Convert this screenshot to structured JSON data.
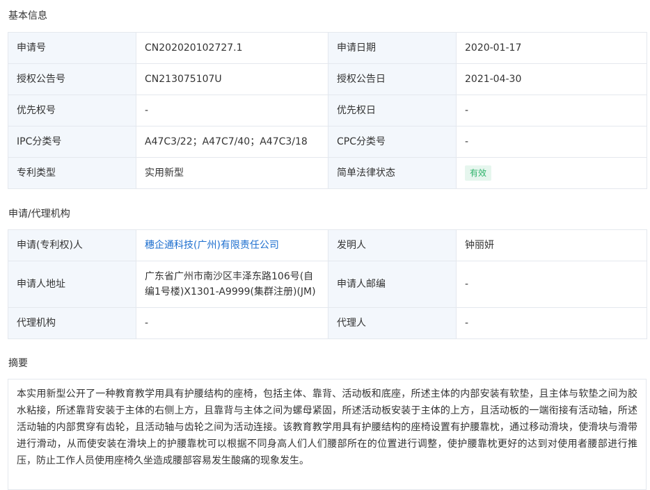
{
  "basic": {
    "title": "基本信息",
    "rows": [
      {
        "k1": "申请号",
        "v1": "CN202020102727.1",
        "k2": "申请日期",
        "v2": "2020-01-17"
      },
      {
        "k1": "授权公告号",
        "v1": "CN213075107U",
        "k2": "授权公告日",
        "v2": "2021-04-30"
      },
      {
        "k1": "优先权号",
        "v1": "-",
        "k2": "优先权日",
        "v2": "-"
      },
      {
        "k1": "IPC分类号",
        "v1": "A47C3/22；A47C7/40；A47C3/18",
        "k2": "CPC分类号",
        "v2": "-"
      },
      {
        "k1": "专利类型",
        "v1": "实用新型",
        "k2": "简单法律状态",
        "v2": "有效"
      }
    ],
    "status_badge": {
      "text_color": "#2fb36b",
      "bg_color": "#e6f6ee"
    }
  },
  "agency": {
    "title": "申请/代理机构",
    "rows": [
      {
        "k1": "申请(专利权)人",
        "v1": "穗企通科技(广州)有限责任公司",
        "k2": "发明人",
        "v2": "钟丽妍"
      },
      {
        "k1": "申请人地址",
        "v1": "广东省广州市南沙区丰泽东路106号(自编1号楼)X1301-A9999(集群注册)(JM)",
        "k2": "申请人邮编",
        "v2": "-"
      },
      {
        "k1": "代理机构",
        "v1": "-",
        "k2": "代理人",
        "v2": "-"
      }
    ],
    "link_color": "#1e6fcf"
  },
  "abstract": {
    "title": "摘要",
    "text": "本实用新型公开了一种教育教学用具有护腰结构的座椅，包括主体、靠背、活动板和底座，所述主体的内部安装有软垫，且主体与软垫之间为胶水粘接，所述靠背安装于主体的右侧上方，且靠背与主体之间为螺母紧固，所述活动板安装于主体的上方，且活动板的一端衔接有活动轴，所述活动轴的内部贯穿有齿轮，且活动轴与齿轮之间为活动连接。该教育教学用具有护腰结构的座椅设置有护腰靠枕，通过移动滑块，使滑块与滑带进行滑动，从而使安装在滑块上的护腰靠枕可以根据不同身高人们人们腰部所在的位置进行调整，使护腰靠枕更好的达到对使用者腰部进行推压，防止工作人员使用座椅久坐造成腰部容易发生酸痛的现象发生。"
  },
  "colors": {
    "label_bg": "#f3f7fc",
    "border": "#e4e8ee"
  }
}
